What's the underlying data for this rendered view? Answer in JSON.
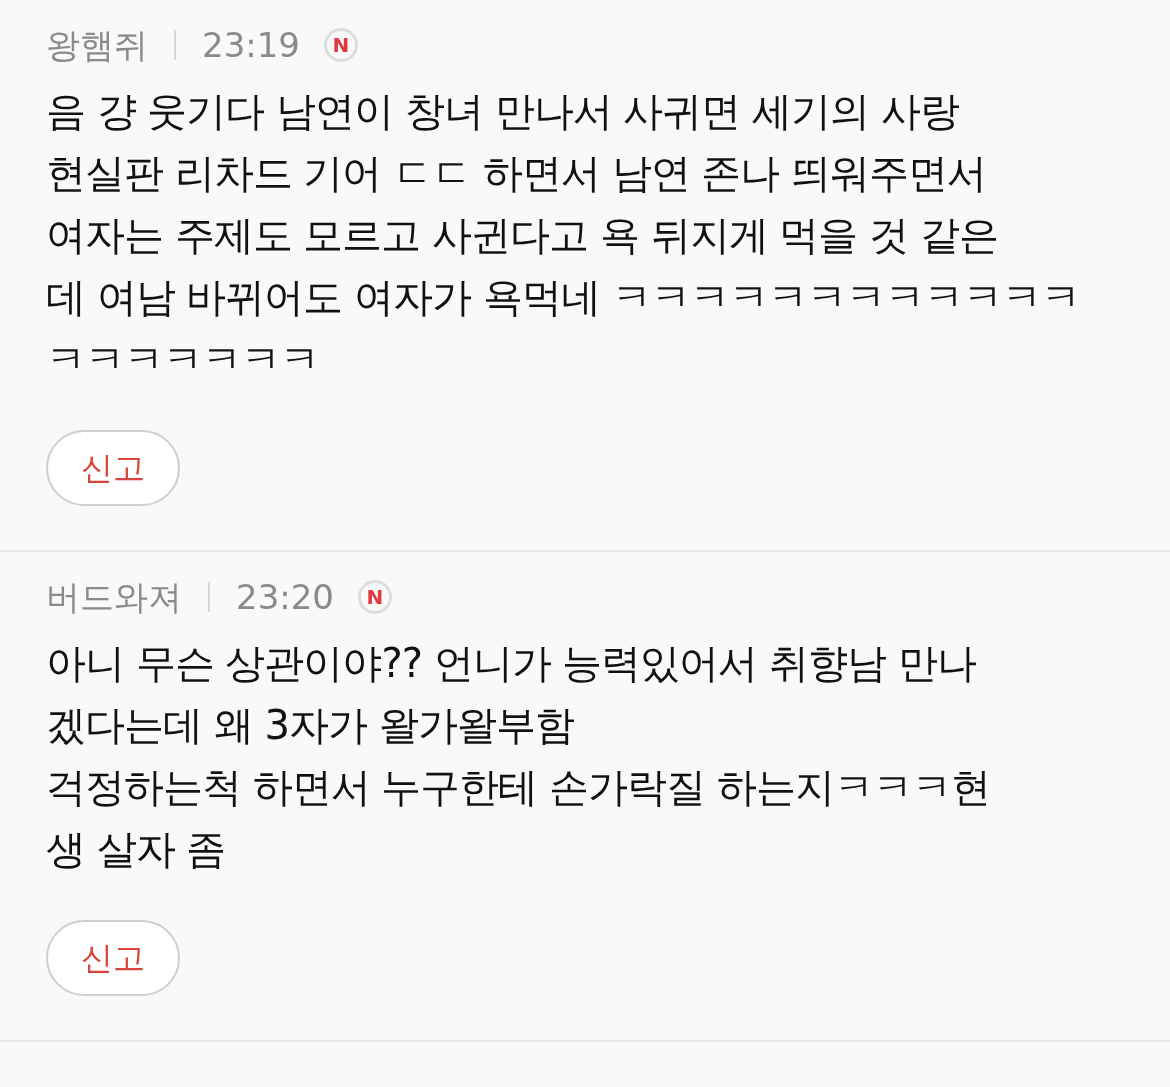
{
  "comments": [
    {
      "author": "왕햄쥐",
      "time": "23:19",
      "badge": "N",
      "lines": [
        "음 걍 웃기다 남연이 창녀 만나서 사귀면 세기의 사랑",
        "현실판 리차드 기어 ㄷㄷ 하면서 남연 존나 띄워주면서",
        "여자는 주제도 모르고 사귄다고 욕 뒤지게 먹을 것 같은",
        "데 여남 바뀌어도 여자가 욕먹네 ㅋㅋㅋㅋㅋㅋㅋㅋㅋㅋㅋㅋ",
        "ㅋㅋㅋㅋㅋㅋㅋ"
      ],
      "report": "신고"
    },
    {
      "author": "버드와져",
      "time": "23:20",
      "badge": "N",
      "lines": [
        "아니 무슨 상관이야?? 언니가 능력있어서 취향남 만나",
        "겠다는데 왜 3자가 왈가왈부함",
        "걱정하는척 하면서 누구한테 손가락질 하는지ㅋㅋㅋ현",
        "생 살자 좀"
      ],
      "report": "신고"
    }
  ]
}
